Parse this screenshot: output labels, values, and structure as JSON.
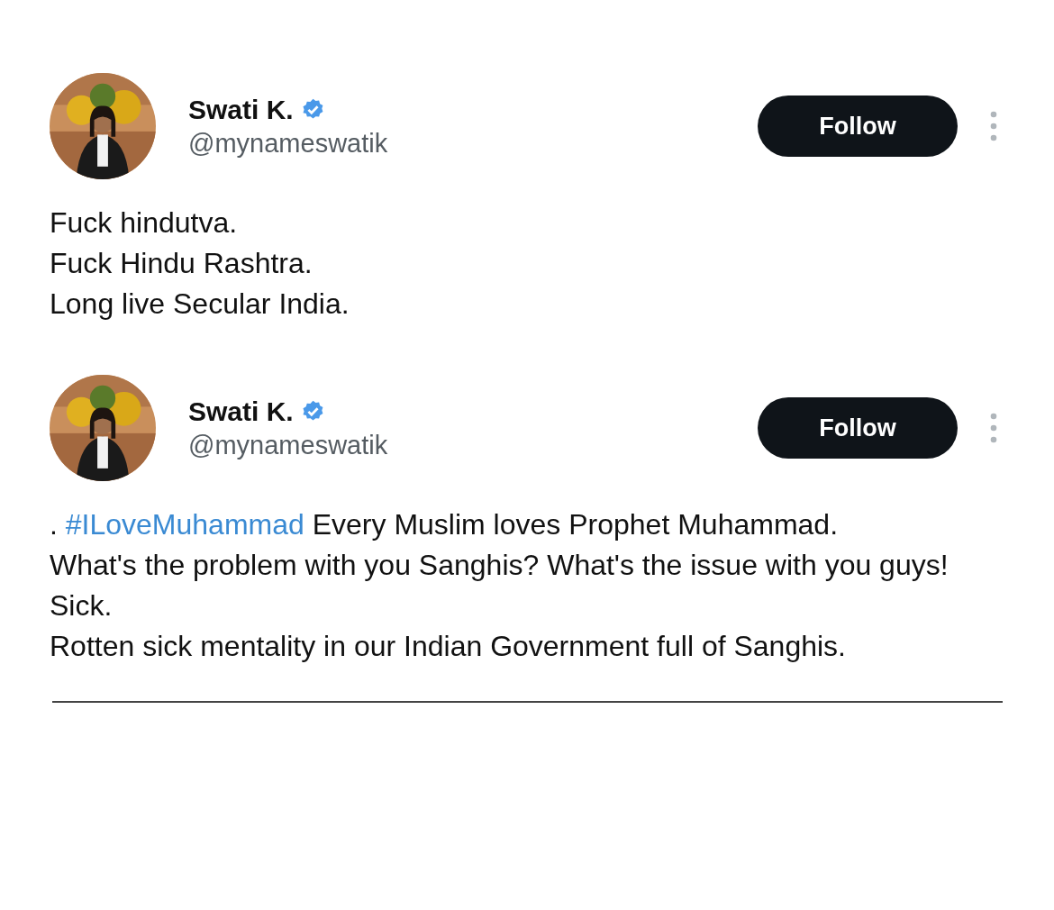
{
  "tweets": [
    {
      "author": {
        "name": "Swati K.",
        "handle": "@mynameswatik",
        "verified": true
      },
      "follow": {
        "label": "Follow"
      },
      "paragraphs": [
        [
          {
            "kind": "plain",
            "text": "Fuck hindutva."
          }
        ],
        [
          {
            "kind": "plain",
            "text": "Fuck Hindu Rashtra."
          }
        ],
        [
          {
            "kind": "plain",
            "text": "Long live Secular India."
          }
        ]
      ]
    },
    {
      "author": {
        "name": "Swati K.",
        "handle": "@mynameswatik",
        "verified": true
      },
      "follow": {
        "label": "Follow"
      },
      "paragraphs": [
        [
          {
            "kind": "plain",
            "text": ". "
          },
          {
            "kind": "hashtag",
            "text": "#ILoveMuhammad"
          },
          {
            "kind": "plain",
            "text": " Every Muslim loves Prophet Muhammad."
          }
        ],
        [
          {
            "kind": "plain",
            "text": "What's the problem with you Sanghis? What's the issue with you guys! Sick."
          }
        ],
        [
          {
            "kind": "plain",
            "text": "Rotten sick mentality in our Indian Government full of Sanghis."
          }
        ]
      ]
    }
  ]
}
